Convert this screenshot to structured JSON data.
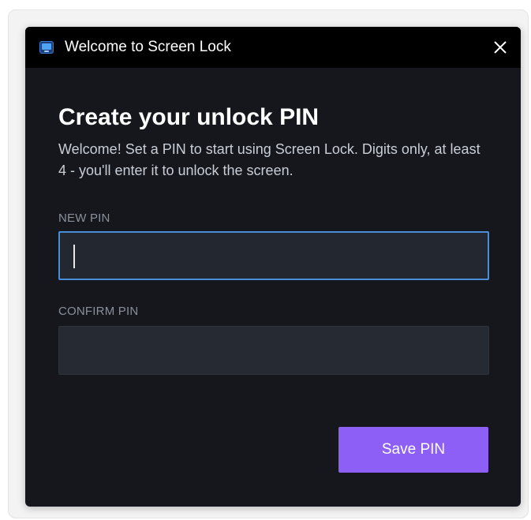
{
  "window": {
    "title": "Welcome to Screen Lock",
    "app_icon": "screen-lock-app-icon",
    "close_icon": "close-icon"
  },
  "content": {
    "heading": "Create your unlock PIN",
    "description": "Welcome! Set a PIN to start using Screen Lock. Digits only, at least 4 - you'll enter it to unlock the screen."
  },
  "form": {
    "new_pin_label": "NEW PIN",
    "new_pin_value": "",
    "confirm_pin_label": "CONFIRM PIN",
    "confirm_pin_value": "",
    "save_label": "Save PIN"
  },
  "colors": {
    "dialog_background": "#15171c",
    "titlebar_background": "#000000",
    "input_background": "#262a32",
    "focus_border": "#4a8fd6",
    "accent_button": "#8e5ff6"
  }
}
